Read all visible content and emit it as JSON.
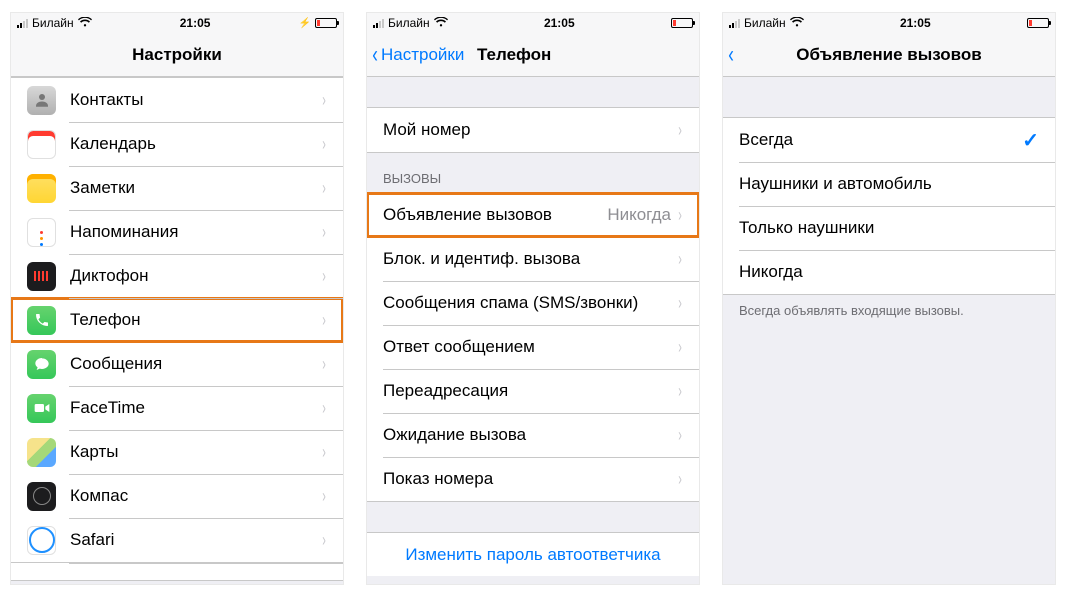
{
  "statusbar": {
    "carrier": "Билайн",
    "time": "21:05"
  },
  "screen1": {
    "title": "Настройки",
    "items": [
      {
        "label": "Контакты"
      },
      {
        "label": "Календарь"
      },
      {
        "label": "Заметки"
      },
      {
        "label": "Напоминания"
      },
      {
        "label": "Диктофон"
      },
      {
        "label": "Телефон"
      },
      {
        "label": "Сообщения"
      },
      {
        "label": "FaceTime"
      },
      {
        "label": "Карты"
      },
      {
        "label": "Компас"
      },
      {
        "label": "Safari"
      }
    ]
  },
  "screen2": {
    "back": "Настройки",
    "title": "Телефон",
    "my_number": "Мой номер",
    "calls_header": "Вызовы",
    "rows": [
      {
        "label": "Объявление вызовов",
        "value": "Никогда"
      },
      {
        "label": "Блок. и идентиф. вызова"
      },
      {
        "label": "Сообщения спама (SMS/звонки)"
      },
      {
        "label": "Ответ сообщением"
      },
      {
        "label": "Переадресация"
      },
      {
        "label": "Ожидание вызова"
      },
      {
        "label": "Показ номера"
      }
    ],
    "voicemail_link": "Изменить пароль автоответчика"
  },
  "screen3": {
    "title": "Объявление вызовов",
    "options": [
      {
        "label": "Всегда",
        "selected": true
      },
      {
        "label": "Наушники и автомобиль",
        "selected": false
      },
      {
        "label": "Только наушники",
        "selected": false
      },
      {
        "label": "Никогда",
        "selected": false
      }
    ],
    "footer": "Всегда объявлять входящие вызовы."
  }
}
